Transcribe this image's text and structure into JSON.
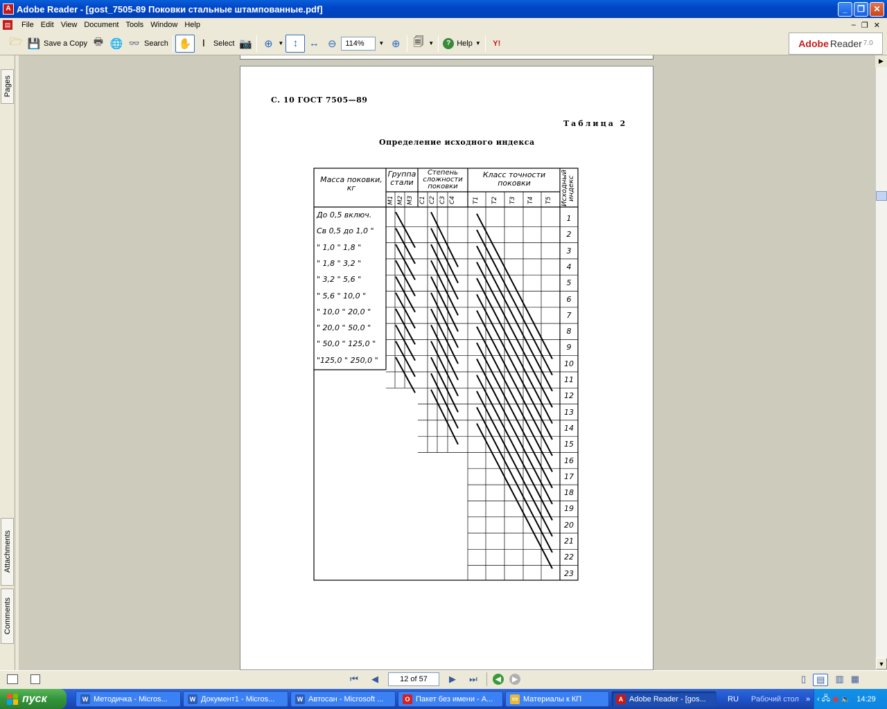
{
  "window": {
    "title": "Adobe Reader - [gost_7505-89 Поковки стальные штампованные.pdf]",
    "app_icon": "acrobat-icon"
  },
  "menu": [
    "File",
    "Edit",
    "View",
    "Document",
    "Tools",
    "Window",
    "Help"
  ],
  "toolbar": {
    "save_copy": "Save a Copy",
    "search": "Search",
    "select": "Select",
    "zoom": "114%",
    "help": "Help",
    "brand_name": "Adobe",
    "brand_product": "Reader",
    "brand_version": "7.0"
  },
  "side_tabs": {
    "pages": "Pages",
    "attachments": "Attachments",
    "comments": "Comments"
  },
  "document": {
    "header": "С. 10 ГОСТ 7505—89",
    "table_label": "Таблица 2",
    "caption": "Определение исходного индекса",
    "col_mass": "Масса поковки, кг",
    "col_group": "Группа стали",
    "col_complexity": "Степень сложности поковки",
    "col_class": "Класс точности поковки",
    "col_index": "Исходный индекс",
    "group_sub": [
      "M1",
      "M2",
      "M3"
    ],
    "complexity_sub": [
      "C1",
      "C2",
      "C3",
      "C4"
    ],
    "class_sub": [
      "T1",
      "T2",
      "T3",
      "T4",
      "T5"
    ],
    "mass_rows": [
      "До 0,5 включ.",
      "Св 0,5 до 1,0 \"",
      "\" 1,0 \" 1,8 \"",
      "\" 1,8 \" 3,2 \"",
      "\" 3,2 \" 5,6 \"",
      "\" 5,6 \" 10,0 \"",
      "\" 10,0 \" 20,0 \"",
      "\" 20,0 \" 50,0 \"",
      "\" 50,0 \" 125,0 \"",
      "\"125,0 \" 250,0 \""
    ],
    "indices": [
      "1",
      "2",
      "3",
      "4",
      "5",
      "6",
      "7",
      "8",
      "9",
      "10",
      "11",
      "12",
      "13",
      "14",
      "15",
      "16",
      "17",
      "18",
      "19",
      "20",
      "21",
      "22",
      "23"
    ]
  },
  "statusbar": {
    "page_display": "12 of 57"
  },
  "taskbar": {
    "start": "пуск",
    "tasks": [
      {
        "label": "Методичка - Micros...",
        "icon": "word-icon"
      },
      {
        "label": "Документ1 - Micros...",
        "icon": "word-icon"
      },
      {
        "label": "Автосан - Microsoft ...",
        "icon": "word-icon"
      },
      {
        "label": "Пакет без имени - А...",
        "icon": "opera-icon"
      },
      {
        "label": "Материалы к КП",
        "icon": "folder-icon"
      },
      {
        "label": "Adobe Reader - [gos...",
        "icon": "acrobat-icon"
      }
    ],
    "lang": "RU",
    "desktop": "Рабочий стол",
    "clock": "14:29"
  }
}
